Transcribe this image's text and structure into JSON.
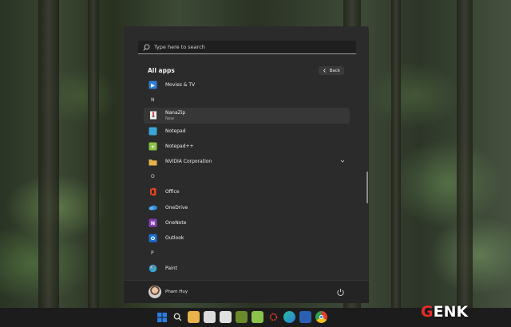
{
  "search": {
    "placeholder": "Type here to search"
  },
  "all_apps": {
    "title": "All apps",
    "back_label": "Back"
  },
  "list": [
    {
      "kind": "app",
      "name": "Movies & TV",
      "icon": "movies-tv-icon",
      "color": "#2f7fd8"
    },
    {
      "kind": "letter",
      "label": "N"
    },
    {
      "kind": "app",
      "name": "NanaZip",
      "sub": "New",
      "icon": "nanazip-icon",
      "selected": true
    },
    {
      "kind": "app",
      "name": "Notepad",
      "icon": "notepad-icon",
      "color": "#3aa6d8"
    },
    {
      "kind": "app",
      "name": "Notepad++",
      "icon": "notepad-plus-plus-icon",
      "color": "#8bc34a"
    },
    {
      "kind": "app",
      "name": "NVIDIA Corporation",
      "icon": "folder-icon",
      "color": "#e8b34a",
      "folder": true
    },
    {
      "kind": "letter",
      "label": "O"
    },
    {
      "kind": "app",
      "name": "Office",
      "icon": "office-icon",
      "color": "#e3411f"
    },
    {
      "kind": "app",
      "name": "OneDrive",
      "icon": "onedrive-icon",
      "color": "#2f8ee0"
    },
    {
      "kind": "app",
      "name": "OneNote",
      "icon": "onenote-icon",
      "color": "#8a3fb8"
    },
    {
      "kind": "app",
      "name": "Outlook",
      "icon": "outlook-icon",
      "color": "#1a6fd0"
    },
    {
      "kind": "letter",
      "label": "P"
    },
    {
      "kind": "app",
      "name": "Paint",
      "icon": "paint-icon",
      "color": "#3aa0d8"
    }
  ],
  "user": {
    "name": "Pham Huy"
  },
  "taskbar": [
    {
      "name": "start-icon",
      "color": "#2b7de0"
    },
    {
      "name": "search-icon",
      "color": "#1c1c1c"
    },
    {
      "name": "file-explorer-icon",
      "color": "#e8b34a"
    },
    {
      "name": "app-icon",
      "color": "#dcdcdc"
    },
    {
      "name": "calendar-icon",
      "color": "#e0e0e0"
    },
    {
      "name": "v-app-icon",
      "color": "#6a8a2a"
    },
    {
      "name": "notepad-plus-plus-icon",
      "color": "#8bc34a"
    },
    {
      "name": "settings-icon",
      "color": "#1c1c1c"
    },
    {
      "name": "edge-icon",
      "color": "#2a9fd8"
    },
    {
      "name": "word-icon",
      "color": "#2b5fb3"
    },
    {
      "name": "chrome-icon",
      "color": "#e0a020"
    }
  ],
  "brand": {
    "g": "G",
    "rest": "ENK"
  }
}
